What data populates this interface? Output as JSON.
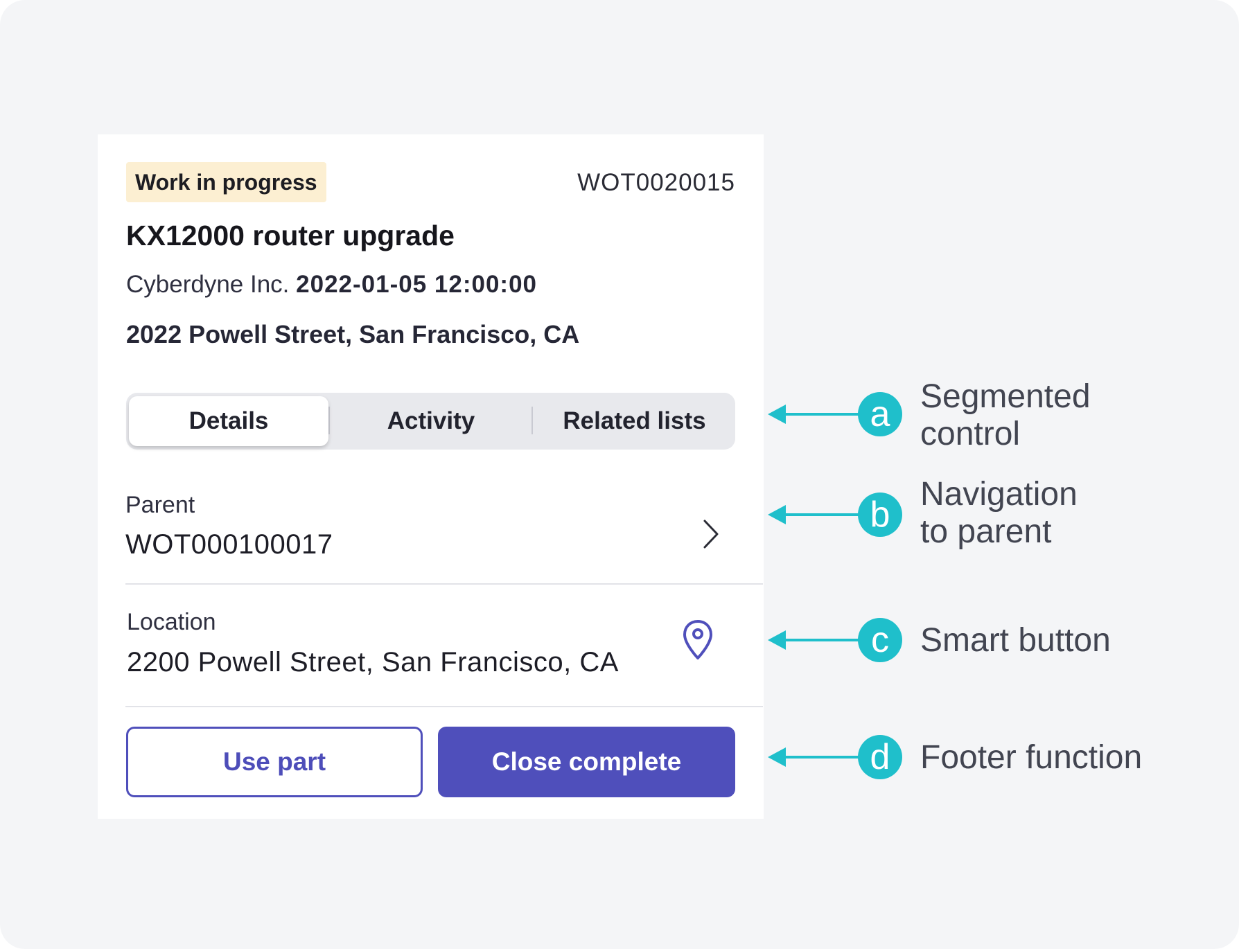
{
  "card": {
    "status_badge": "Work in progress",
    "work_order_number": "WOT0020015",
    "title": "KX12000 router upgrade",
    "company": "Cyberdyne Inc.",
    "datetime": "2022-01-05 12:00:00",
    "address": "2022 Powell Street, San Francisco, CA"
  },
  "segmented_control": {
    "tabs": [
      {
        "label": "Details",
        "selected": true
      },
      {
        "label": "Activity",
        "selected": false
      },
      {
        "label": "Related lists",
        "selected": false
      }
    ]
  },
  "fields": {
    "parent": {
      "label": "Parent",
      "value": "WOT000100017",
      "icon": "chevron-right-icon"
    },
    "location": {
      "label": "Location",
      "value": "2200 Powell Street, San Francisco, CA",
      "icon": "map-pin-icon"
    }
  },
  "footer": {
    "secondary_label": "Use part",
    "primary_label": "Close complete"
  },
  "annotations": [
    {
      "letter": "a",
      "line1": "Segmented",
      "line2": "control"
    },
    {
      "letter": "b",
      "line1": "Navigation",
      "line2": "to parent"
    },
    {
      "letter": "c",
      "line1": "Smart button",
      "line2": ""
    },
    {
      "letter": "d",
      "line1": "Footer function",
      "line2": ""
    }
  ],
  "colors": {
    "background": "#f4f5f7",
    "badge_bg": "#fcefd2",
    "primary": "#4f4fbb",
    "annotation_accent": "#1fbfcb"
  }
}
